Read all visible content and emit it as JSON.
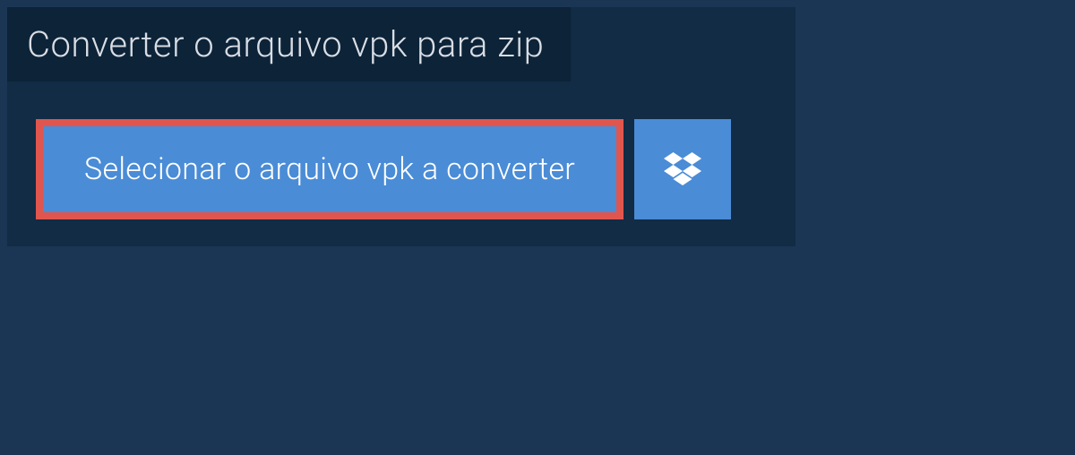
{
  "title": "Converter o arquivo vpk para zip",
  "buttons": {
    "select_file": "Selecionar o arquivo vpk a converter"
  },
  "colors": {
    "page_bg": "#1a3654",
    "panel_bg": "#112c44",
    "title_bg": "#0c2338",
    "button_bg": "#4a8cd6",
    "highlight_border": "#e0564e",
    "text_light": "#d9dde4",
    "text_white": "#ffffff"
  }
}
